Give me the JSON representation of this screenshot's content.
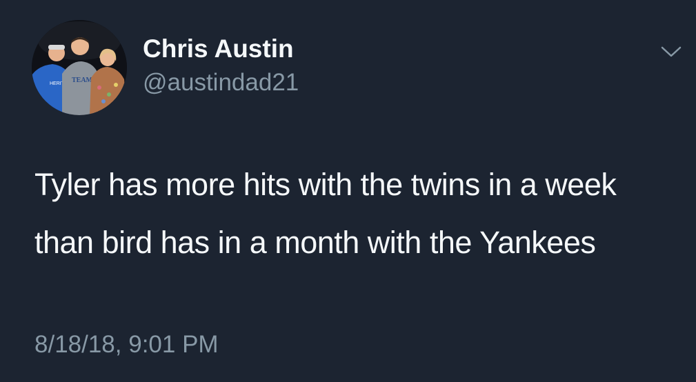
{
  "tweet": {
    "author": {
      "display_name": "Chris Austin",
      "handle": "@austindad21",
      "avatar_icon": "profile-photo"
    },
    "text": "Tyler has more hits with the twins in a week than bird has in a month with the Yankees",
    "timestamp": "8/18/18, 9:01 PM",
    "menu_icon": "chevron-down-icon"
  },
  "colors": {
    "background": "#1c2431",
    "primary_text": "#f5f8fa",
    "secondary_text": "#8899a6"
  }
}
